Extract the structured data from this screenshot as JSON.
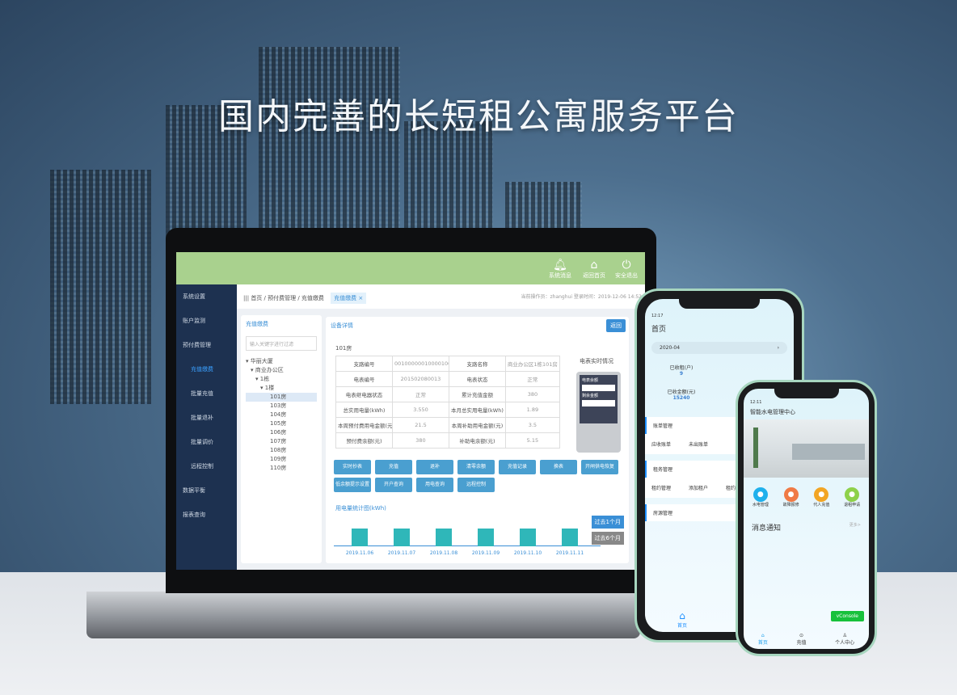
{
  "headline": "国内完善的长短租公寓服务平台",
  "web": {
    "header": [
      {
        "icon": "bell-icon",
        "label": "系统消息"
      },
      {
        "icon": "home-icon",
        "label": "返回首页"
      },
      {
        "icon": "power-icon",
        "label": "安全退出"
      }
    ],
    "sidebar": [
      {
        "label": "系统设置",
        "sub": false
      },
      {
        "label": "账户监测",
        "sub": false
      },
      {
        "label": "预付费管理",
        "sub": false
      },
      {
        "label": "充值缴费",
        "sub": true,
        "active": true
      },
      {
        "label": "批量充值",
        "sub": true
      },
      {
        "label": "批量退补",
        "sub": true
      },
      {
        "label": "批量调价",
        "sub": true
      },
      {
        "label": "远程控制",
        "sub": true
      },
      {
        "label": "数据平衡",
        "sub": false
      },
      {
        "label": "报表查询",
        "sub": false
      }
    ],
    "breadcrumb": "首页 / 预付费管理 / 充值缴费",
    "tab": "充值缴费 ×",
    "user_info": "当前操作员：zhanghui  登录时间：2019-12-06 14:52",
    "left_panel": {
      "title": "充值缴费",
      "search_placeholder": "输入关键字进行过滤",
      "tree": [
        "▾ 华丽大厦",
        "▾ 商业办公区",
        "▾ 1栋",
        "▾ 1楼",
        "101房",
        "103房",
        "104房",
        "105房",
        "106房",
        "107房",
        "108房",
        "109房",
        "110房"
      ]
    },
    "main": {
      "title": "设备详情",
      "back": "返回",
      "room": "101房",
      "table": [
        [
          "支路编号",
          "00100000010000100000...",
          "支路名称",
          "商业办公区1栋101房"
        ],
        [
          "电表编号",
          "201502080013",
          "电表状态",
          "正常"
        ],
        [
          "电表继电器状态",
          "正常",
          "累计充值金额",
          "380"
        ],
        [
          "总实用电量(kWh)",
          "3.550",
          "本月总实用电量(kWh)",
          "1.89"
        ],
        [
          "本周预付费用电金额(元)",
          "21.5",
          "本周补助用电金额(元)",
          "3.5"
        ],
        [
          "预付费余额(元)",
          "380",
          "补助电余额(元)",
          "5.15"
        ]
      ],
      "meter_title": "电表实时情况",
      "meter_labels": [
        "电表余额",
        "剩余金额"
      ],
      "buttons": [
        "实时抄表",
        "充值",
        "退补",
        "清零余额",
        "充值记录",
        "换表",
        "开闸供电恢复",
        "低余额提示设置",
        "开户查询",
        "用电查询",
        "远程控制"
      ],
      "chart_title": "用电量统计图(kWh)",
      "chart_buttons": [
        "过去1个月",
        "过去6个月"
      ]
    }
  },
  "chart_data": {
    "type": "bar",
    "categories": [
      "2019.11.06",
      "2019.11.07",
      "2019.11.08",
      "2019.11.09",
      "2019.11.10",
      "2019.11.11"
    ],
    "values": [
      1,
      1,
      1,
      1,
      1,
      1
    ],
    "title": "用电量统计图(kWh)"
  },
  "phone1": {
    "status": "12:17",
    "title": "首页",
    "month": "2020-04",
    "stats": [
      {
        "label": "已收租(户)",
        "value": "9"
      },
      {
        "label": "已收金额(元)",
        "value": "15240"
      }
    ],
    "sections": [
      {
        "title": "账单管理",
        "items": [
          "应收账单",
          "未出账单"
        ]
      },
      {
        "title": "租务管理",
        "items": [
          "租约管理",
          "添加租户",
          "租约"
        ]
      },
      {
        "title": "房源管理",
        "items": []
      }
    ],
    "tab": "首页"
  },
  "phone2": {
    "status": "12:11",
    "title": "智能水电管理中心",
    "actions": [
      {
        "label": "水电管理",
        "color": "#1fb0ec"
      },
      {
        "label": "故障报修",
        "color": "#f07a45"
      },
      {
        "label": "代人充值",
        "color": "#f2a524"
      },
      {
        "label": "退租申请",
        "color": "#8ed14a"
      }
    ],
    "notice": "消息通知",
    "more": "更多>",
    "vconsole": "vConsole",
    "tabs": [
      "首页",
      "充值",
      "个人中心"
    ]
  }
}
